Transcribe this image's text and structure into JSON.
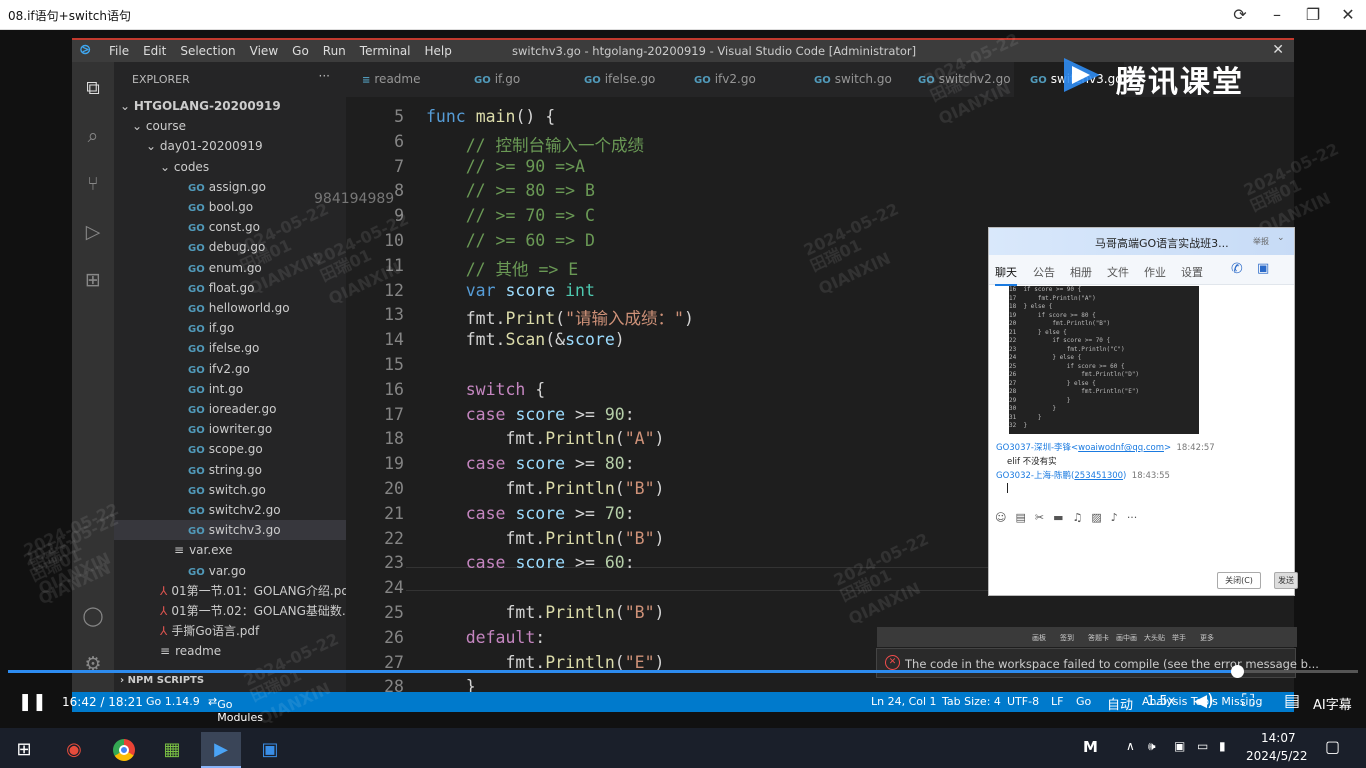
{
  "player": {
    "title": "08.if语句+switch语句",
    "elapsed_time": "16:42",
    "total_time": "18:21",
    "time_display": "16:42 / 18:21",
    "progress_fraction": 0.91,
    "quality_label": "自动",
    "speed_label": "1.5x",
    "subtitle_label": "AI字幕"
  },
  "watermark": {
    "id_text": "984194989",
    "date": "2024-05-22",
    "name": "田瑞01",
    "latin": "QIANXIN"
  },
  "vscode": {
    "menu": [
      "File",
      "Edit",
      "Selection",
      "View",
      "Go",
      "Run",
      "Terminal",
      "Help"
    ],
    "window_title": "switchv3.go - htgolang-20200919 - Visual Studio Code [Administrator]",
    "tabs": [
      "readme",
      "if.go",
      "ifelse.go",
      "ifv2.go",
      "switch.go",
      "switchv2.go",
      "switchv3.go"
    ],
    "active_tab": "switchv3.go",
    "explorer_title": "EXPLORER",
    "tree": [
      {
        "label": "HTGOLANG-20200919",
        "kind": "root"
      },
      {
        "label": "course",
        "kind": "folder"
      },
      {
        "label": "day01-20200919",
        "kind": "folder"
      },
      {
        "label": "codes",
        "kind": "folder"
      },
      {
        "label": "assign.go",
        "kind": "go"
      },
      {
        "label": "bool.go",
        "kind": "go"
      },
      {
        "label": "const.go",
        "kind": "go"
      },
      {
        "label": "debug.go",
        "kind": "go"
      },
      {
        "label": "enum.go",
        "kind": "go"
      },
      {
        "label": "float.go",
        "kind": "go"
      },
      {
        "label": "helloworld.go",
        "kind": "go"
      },
      {
        "label": "if.go",
        "kind": "go"
      },
      {
        "label": "ifelse.go",
        "kind": "go"
      },
      {
        "label": "ifv2.go",
        "kind": "go"
      },
      {
        "label": "int.go",
        "kind": "go"
      },
      {
        "label": "ioreader.go",
        "kind": "go"
      },
      {
        "label": "iowriter.go",
        "kind": "go"
      },
      {
        "label": "scope.go",
        "kind": "go"
      },
      {
        "label": "string.go",
        "kind": "go"
      },
      {
        "label": "switch.go",
        "kind": "go"
      },
      {
        "label": "switchv2.go",
        "kind": "go"
      },
      {
        "label": "switchv3.go",
        "kind": "go"
      },
      {
        "label": "var.exe",
        "kind": "file"
      },
      {
        "label": "var.go",
        "kind": "go"
      },
      {
        "label": "01第一节.01：GOLANG介绍.pdf",
        "kind": "pdf"
      },
      {
        "label": "01第一节.02：GOLANG基础数...",
        "kind": "pdf"
      },
      {
        "label": "手撕Go语言.pdf",
        "kind": "pdf"
      },
      {
        "label": "readme",
        "kind": "file"
      }
    ],
    "npm_scripts_label": "NPM SCRIPTS",
    "line_numbers": [
      "5",
      "6",
      "7",
      "8",
      "9",
      "10",
      "11",
      "12",
      "13",
      "14",
      "15",
      "16",
      "17",
      "18",
      "19",
      "20",
      "21",
      "22",
      "23",
      "24",
      "25",
      "26",
      "27",
      "28"
    ],
    "code_lines": [
      "func main() {",
      "    // 控制台输入一个成绩",
      "    // >= 90 =>A",
      "    // >= 80 => B",
      "    // >= 70 => C",
      "    // >= 60 => D",
      "    // 其他 => E",
      "    var score int",
      "    fmt.Print(\"请输入成绩：\")",
      "    fmt.Scan(&score)",
      "",
      "    switch {",
      "    case score >= 90:",
      "        fmt.Println(\"A\")",
      "    case score >= 80:",
      "        fmt.Println(\"B\")",
      "    case score >= 70:",
      "        fmt.Println(\"B\")",
      "    case score >= 60:",
      "    ",
      "        fmt.Println(\"B\")",
      "    default:",
      "        fmt.Println(\"E\")",
      "    }"
    ],
    "status": {
      "go_version": "Go 1.14.9",
      "go_modules": "Go Modules",
      "cursor": "Ln 24, Col 1",
      "tab_size": "Tab Size: 4",
      "encoding": "UTF-8",
      "eol": "LF",
      "language": "Go",
      "analysis": "Analysis Tools Missing"
    },
    "error_message": "The code in the workspace failed to compile (see the error message b..."
  },
  "brand": {
    "logo_text": "腾讯课堂"
  },
  "chat": {
    "title": "马哥高端GO语言实战班3...",
    "report": "举报",
    "tabs": [
      "聊天",
      "公告",
      "相册",
      "文件",
      "作业",
      "设置"
    ],
    "code_snippet_lines": [
      "16  if score >= 90 {",
      "17      fmt.Println(\"A\")",
      "18  } else {",
      "19      if score >= 80 {",
      "20          fmt.Println(\"B\")",
      "21      } else {",
      "22          if score >= 70 {",
      "23              fmt.Println(\"C\")",
      "24          } else {",
      "25              if score >= 60 {",
      "26                  fmt.Println(\"D\")",
      "27              } else {",
      "28                  fmt.Println(\"E\")",
      "29              }",
      "30          }",
      "31      }",
      "32  }"
    ],
    "messages": [
      {
        "sender": "GO3037-深圳-李锋",
        "email": "woaiwodnf@qq.com",
        "time": "18:42:57",
        "text": "elif 不没有实"
      },
      {
        "sender": "GO3032-上海-陈鹏",
        "email": "253451300",
        "time": "18:43:55",
        "text": ""
      }
    ],
    "close_button": "关闭(C)",
    "send_button": "发送"
  },
  "toast_toolbar": [
    "画板",
    "签到",
    "答题卡",
    "画中画",
    "大头贴",
    "举手",
    "更多"
  ],
  "taskbar": {
    "time": "14:07",
    "date": "2024/5/22",
    "ime": "M"
  }
}
